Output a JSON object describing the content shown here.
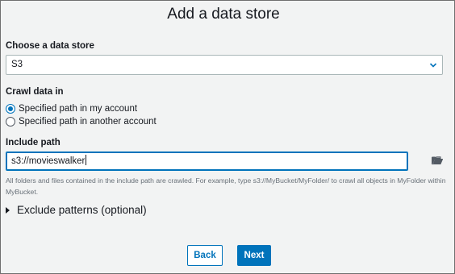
{
  "page": {
    "title": "Add a data store"
  },
  "data_store": {
    "label": "Choose a data store",
    "selected": "S3"
  },
  "crawl": {
    "label": "Crawl data in",
    "options": [
      {
        "label": "Specified path in my account",
        "checked": true
      },
      {
        "label": "Specified path in another account",
        "checked": false
      }
    ]
  },
  "include_path": {
    "label": "Include path",
    "value": "s3://movieswalker",
    "help": "All folders and files contained in the include path are crawled. For example, type s3://MyBucket/MyFolder/ to crawl all objects in MyFolder within MyBucket."
  },
  "exclude": {
    "label": "Exclude patterns (optional)"
  },
  "buttons": {
    "back": "Back",
    "next": "Next"
  },
  "colors": {
    "accent": "#0073bb",
    "background": "#f2f3f3",
    "text": "#16191f",
    "muted": "#687078"
  },
  "icons": {
    "select": "chevron-down-icon",
    "browse": "folder-open-icon",
    "expand": "caret-right-icon"
  }
}
